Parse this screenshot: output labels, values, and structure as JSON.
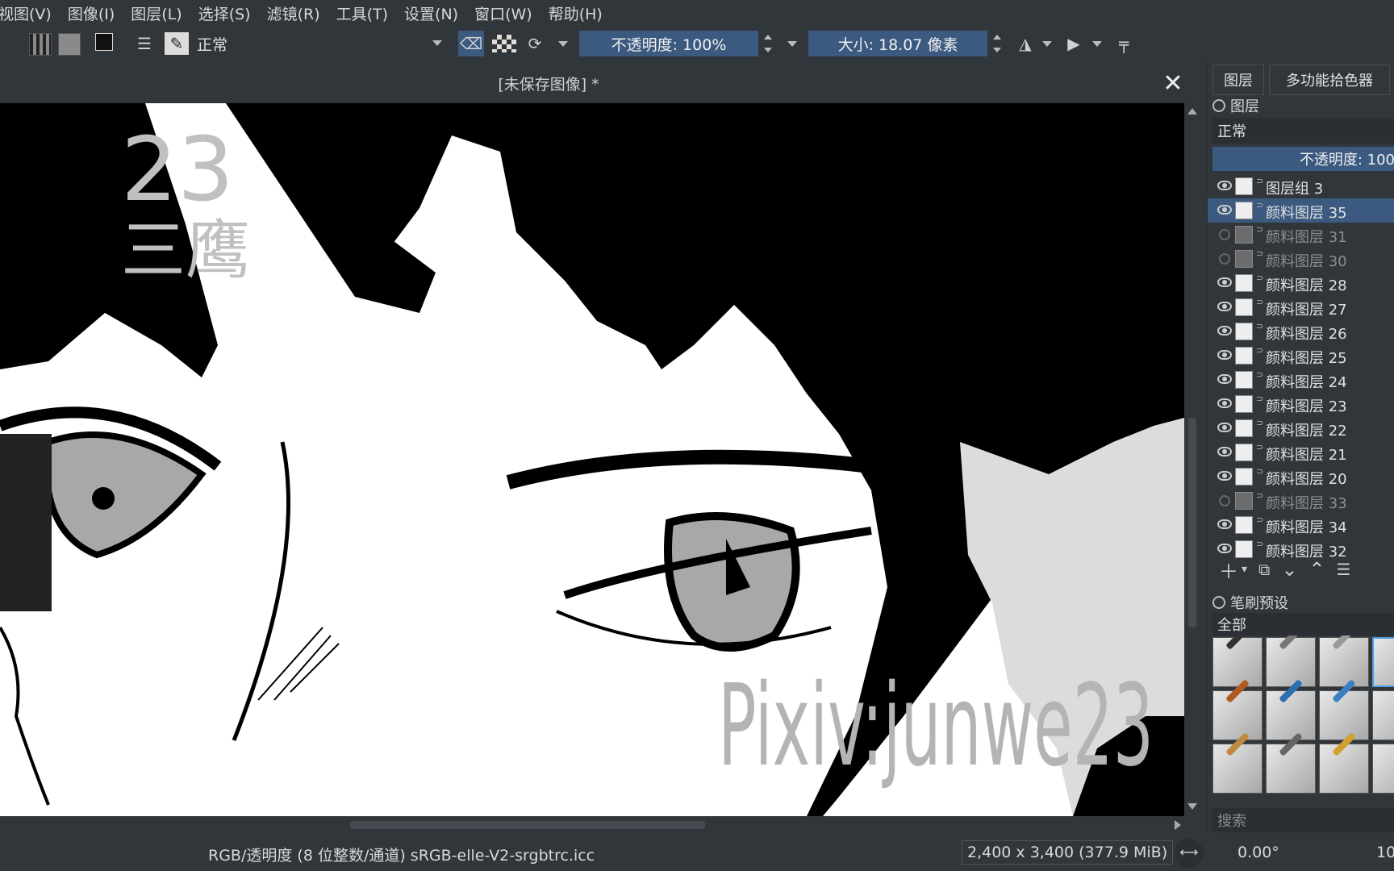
{
  "menu": [
    "视图(V)",
    "图像(I)",
    "图层(L)",
    "选择(S)",
    "滤镜(R)",
    "工具(T)",
    "设置(N)",
    "窗口(W)",
    "帮助(H)"
  ],
  "toolbar": {
    "blend_mode": "正常",
    "opacity": "不透明度: 100%",
    "size": "大小: 18.07 像素"
  },
  "document": {
    "title": "[未保存图像]  *",
    "close": "✕"
  },
  "canvas": {
    "watermark": "Pixiv:junwe23",
    "watermark_top": "23",
    "watermark_author": "三鹰"
  },
  "docker": {
    "tabs": [
      "图层",
      "多功能拾色器"
    ],
    "layers_title": "图层",
    "blend_mode": "正常",
    "opacity": "不透明度: 100",
    "layers": [
      {
        "name": "图层组 3",
        "visible": true,
        "selected": false
      },
      {
        "name": "颜料图层 35",
        "visible": true,
        "selected": true
      },
      {
        "name": "颜料图层 31",
        "visible": false,
        "selected": false
      },
      {
        "name": "颜料图层 30",
        "visible": false,
        "selected": false
      },
      {
        "name": "颜料图层 28",
        "visible": true,
        "selected": false
      },
      {
        "name": "颜料图层 27",
        "visible": true,
        "selected": false
      },
      {
        "name": "颜料图层 26",
        "visible": true,
        "selected": false
      },
      {
        "name": "颜料图层 25",
        "visible": true,
        "selected": false
      },
      {
        "name": "颜料图层 24",
        "visible": true,
        "selected": false
      },
      {
        "name": "颜料图层 23",
        "visible": true,
        "selected": false
      },
      {
        "name": "颜料图层 22",
        "visible": true,
        "selected": false
      },
      {
        "name": "颜料图层 21",
        "visible": true,
        "selected": false
      },
      {
        "name": "颜料图层 20",
        "visible": true,
        "selected": false
      },
      {
        "name": "颜料图层 33",
        "visible": false,
        "selected": false
      },
      {
        "name": "颜料图层 34",
        "visible": true,
        "selected": false
      },
      {
        "name": "颜料图层 32",
        "visible": true,
        "selected": false
      }
    ],
    "brush_title": "笔刷预设",
    "brush_filter": "全部",
    "search_placeholder": "搜索"
  },
  "status": {
    "color_space": "RGB/透明度 (8 位整数/通道)  sRGB-elle-V2-srgbtrc.icc",
    "dimensions": "2,400 x 3,400 (377.9 MiB)",
    "rotation": "0.00°",
    "zoom": "10"
  }
}
